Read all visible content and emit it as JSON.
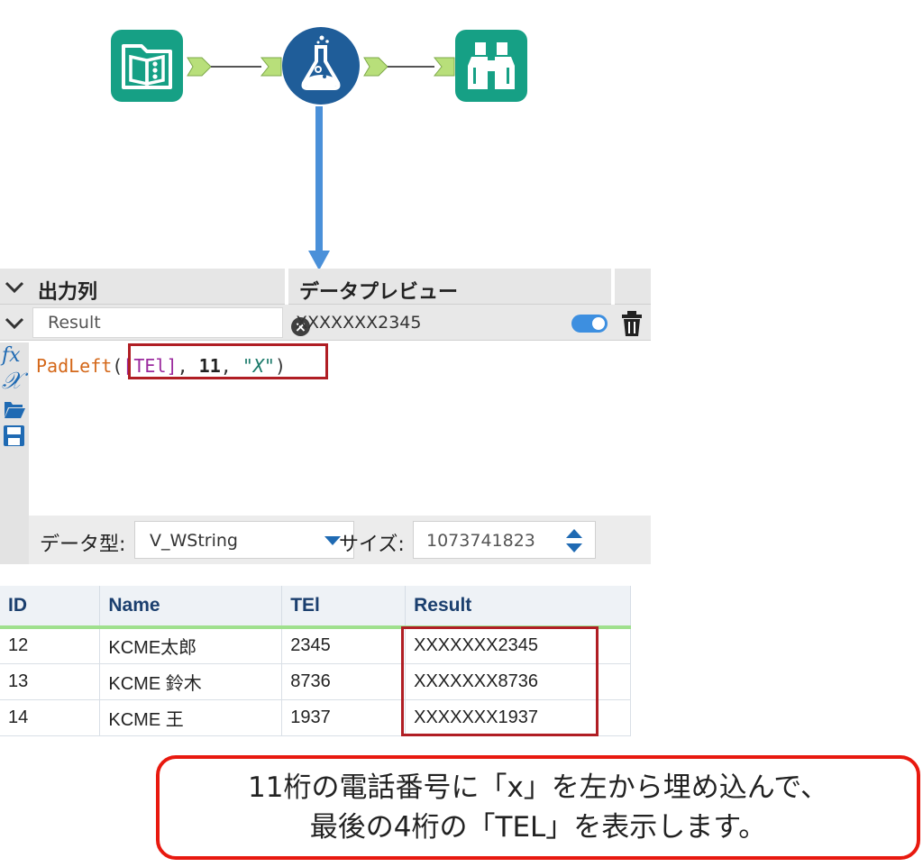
{
  "workflow": {
    "tools": [
      {
        "name": "input-data-icon"
      },
      {
        "name": "formula-icon"
      },
      {
        "name": "browse-icon"
      }
    ]
  },
  "formula_panel": {
    "header": {
      "output_column_label": "出力列",
      "data_preview_label": "データプレビュー"
    },
    "row": {
      "output_column_value": "Result",
      "preview_value": "XXXXXXX2345",
      "enabled": true
    },
    "expression": {
      "function": "PadLeft",
      "open_paren": "(",
      "field": "[TEl]",
      "comma1": ", ",
      "length": "11",
      "comma2": ", ",
      "pad_string": "\"X\"",
      "close_paren": ")"
    },
    "side_buttons": [
      "fx-icon",
      "variable-x-icon",
      "open-folder-icon",
      "save-icon"
    ],
    "footer": {
      "data_type_label": "データ型:",
      "data_type_value": "V_WString",
      "size_label": "サイズ:",
      "size_value": "1073741823"
    }
  },
  "results_table": {
    "columns": [
      "ID",
      "Name",
      "TEl",
      "Result"
    ],
    "rows": [
      [
        "12",
        "KCME太郎",
        "2345",
        "XXXXXXX2345"
      ],
      [
        "13",
        "KCME 鈴木",
        "8736",
        "XXXXXXX8736"
      ],
      [
        "14",
        "KCME 王",
        "1937",
        "XXXXXXX1937"
      ]
    ]
  },
  "callout": {
    "line1": "11桁の電話番号に「x」を左から埋め込んで、",
    "line2": "最後の4桁の「TEL」を表示します。"
  },
  "colors": {
    "tool_teal": "#16a085",
    "formula_blue": "#1f5d99",
    "arrow_blue": "#4a90d9",
    "highlight_red": "#b01e24",
    "callout_red": "#e8190f",
    "header_underline_green": "#9fe08d"
  }
}
